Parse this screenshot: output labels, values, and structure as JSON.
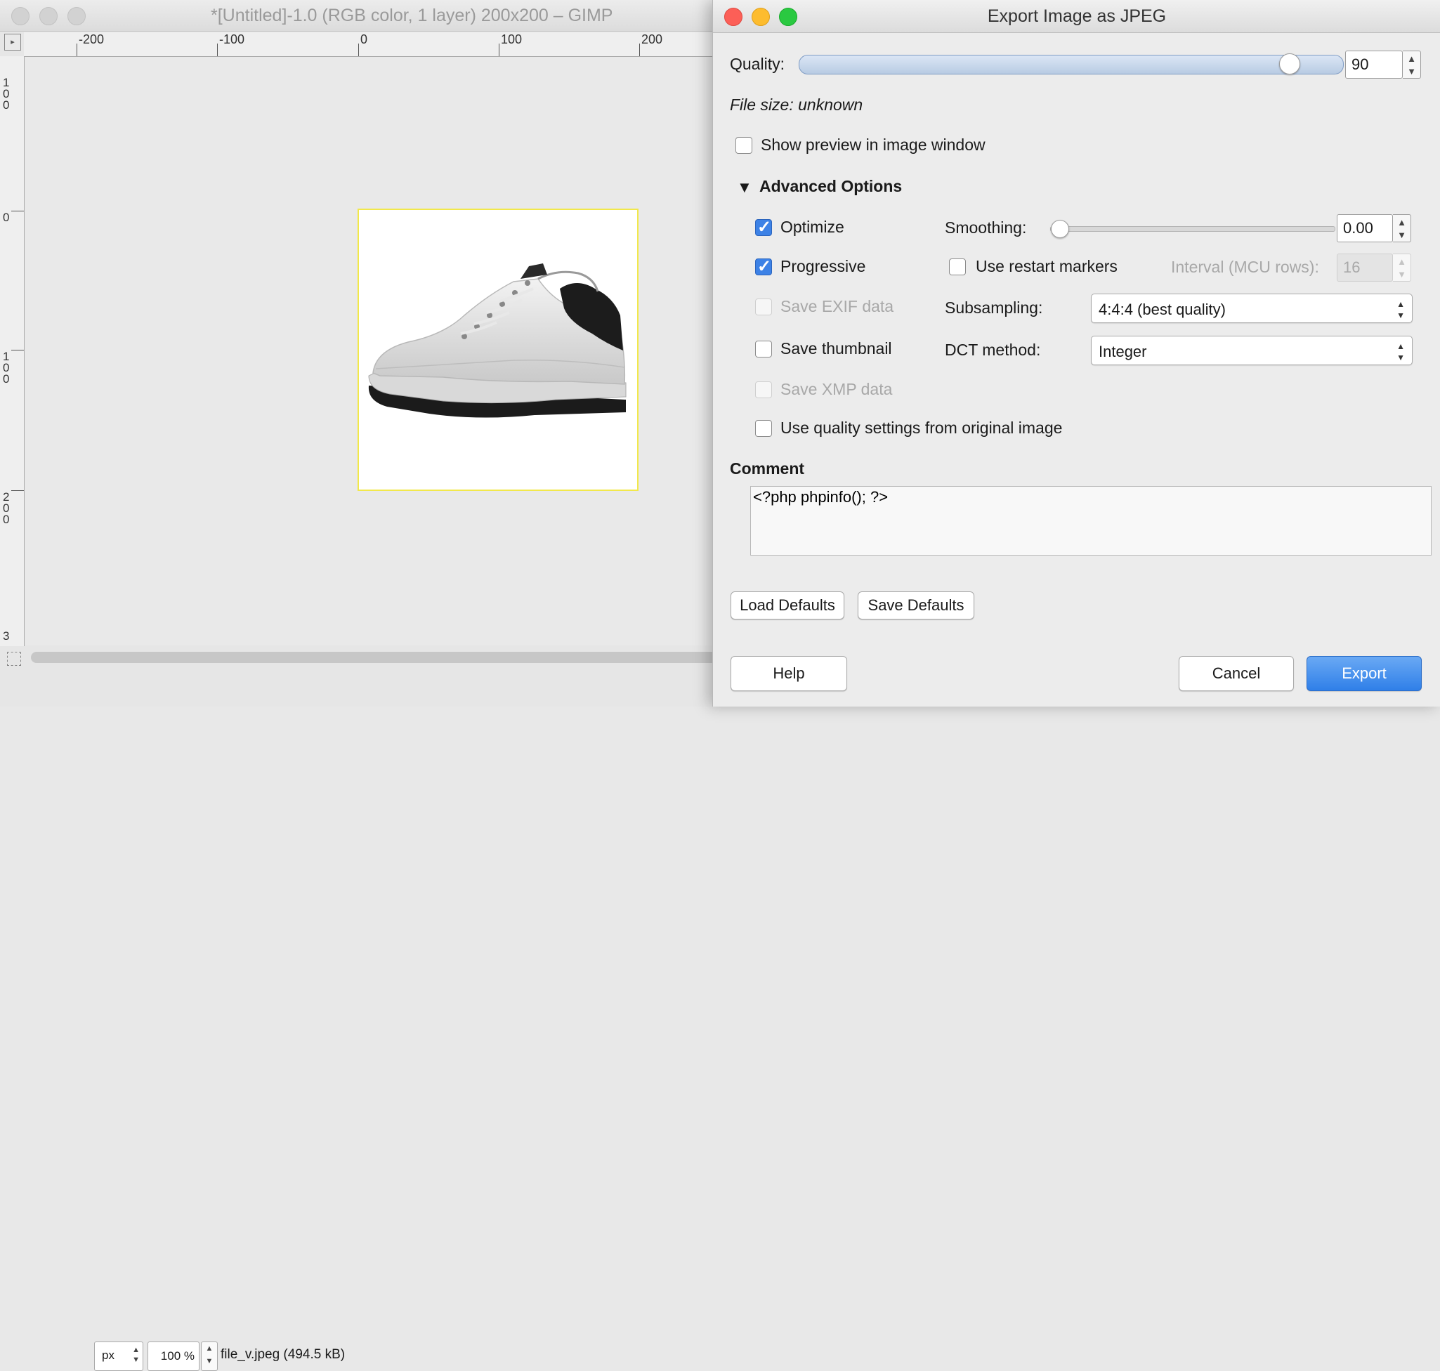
{
  "gimp": {
    "title": "*[Untitled]-1.0 (RGB color, 1 layer) 200x200 – GIMP",
    "hruler_labels": [
      "-200",
      "-100",
      "0",
      "100",
      "200"
    ],
    "vruler_labels": [
      "100",
      "0",
      "100",
      "200",
      "3"
    ],
    "status": {
      "unit": "px",
      "zoom": "100 %",
      "file": "file_v.jpeg (494.5 kB)"
    }
  },
  "dialog": {
    "title": "Export Image as JPEG",
    "quality": {
      "label": "Quality:",
      "value": "90",
      "fraction": 0.9
    },
    "file_size": "File size: unknown",
    "show_preview": {
      "label": "Show preview in image window",
      "checked": false
    },
    "advanced": {
      "header": "Advanced Options",
      "optimize": {
        "label": "Optimize",
        "checked": true
      },
      "progressive": {
        "label": "Progressive",
        "checked": true
      },
      "save_exif": {
        "label": "Save EXIF data",
        "checked": false,
        "enabled": false
      },
      "save_thumbnail": {
        "label": "Save thumbnail",
        "checked": false
      },
      "save_xmp": {
        "label": "Save XMP data",
        "checked": false,
        "enabled": false
      },
      "use_quality_original": {
        "label": "Use quality settings from original image",
        "checked": false
      },
      "smoothing": {
        "label": "Smoothing:",
        "value": "0.00",
        "fraction": 0.0
      },
      "restart_markers": {
        "label": "Use restart markers",
        "checked": false
      },
      "interval": {
        "label": "Interval (MCU rows):",
        "value": "16",
        "enabled": false
      },
      "subsampling": {
        "label": "Subsampling:",
        "value": "4:4:4 (best quality)"
      },
      "dct": {
        "label": "DCT method:",
        "value": "Integer"
      }
    },
    "comment": {
      "label": "Comment",
      "text": "<?php phpinfo(); ?>"
    },
    "buttons": {
      "load_defaults": "Load Defaults",
      "save_defaults": "Save Defaults",
      "help": "Help",
      "cancel": "Cancel",
      "export": "Export"
    }
  }
}
